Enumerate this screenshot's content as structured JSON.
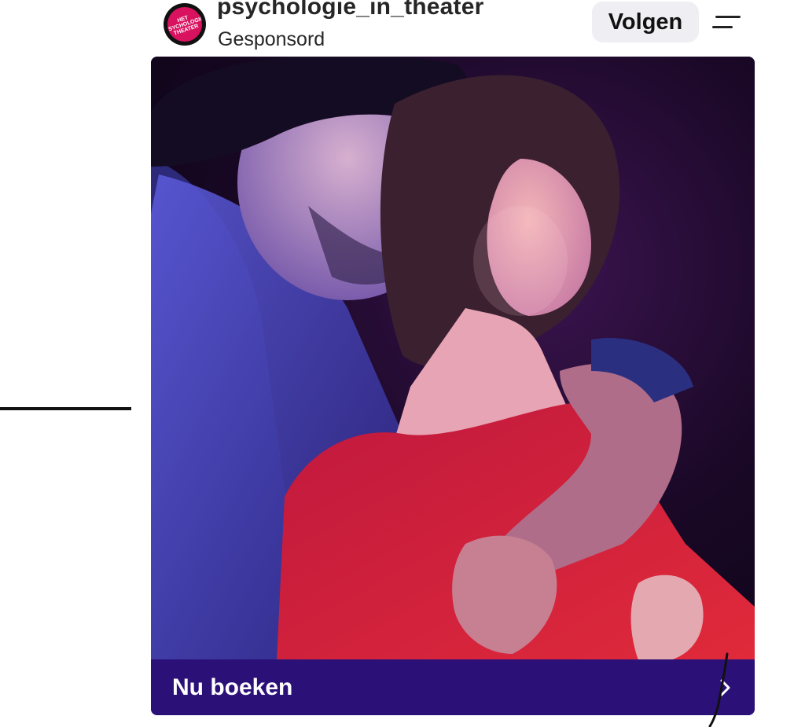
{
  "header": {
    "account_name": "psychologie_in_theater",
    "sponsored_label": "Gesponsord",
    "follow_label": "Volgen",
    "avatar_logo_text": "HET PSYCHOLOGIE THEATER",
    "menu_icon": "hamburger-icon"
  },
  "post": {
    "image_description_icon": "photo",
    "cta_label": "Nu boeken",
    "cta_icon": "chevron-right-icon"
  },
  "colors": {
    "cta_background": "#2b1078",
    "avatar_brand": "#d9125f",
    "follow_button_bg": "#efeff3"
  }
}
